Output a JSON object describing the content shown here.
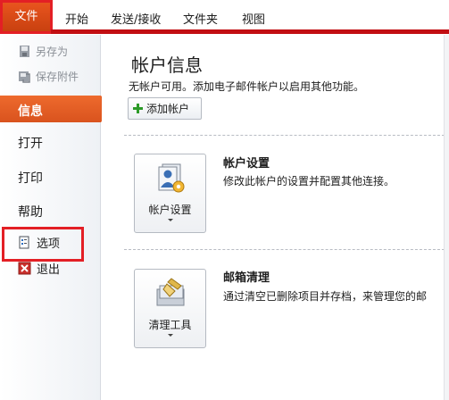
{
  "ribbon": {
    "file_tab": "文件",
    "tabs": [
      "开始",
      "发送/接收",
      "文件夹",
      "视图"
    ]
  },
  "left_nav": {
    "save_as": "另存为",
    "save_attachments": "保存附件",
    "info": "信息",
    "open": "打开",
    "print": "打印",
    "help": "帮助",
    "options": "选项",
    "exit": "退出"
  },
  "main": {
    "title": "帐户信息",
    "subtitle": "无帐户可用。添加电子邮件帐户以启用其他功能。",
    "add_account_label": "添加帐户",
    "account_settings": {
      "button_label": "帐户设置",
      "title": "帐户设置",
      "description": "修改此帐户的设置并配置其他连接。"
    },
    "mailbox_cleanup": {
      "button_label": "清理工具",
      "title": "邮箱清理",
      "description": "通过清空已删除项目并存档，来管理您的邮"
    }
  },
  "colors": {
    "accent_orange": "#e35e24",
    "ribbon_red": "#c20e12",
    "highlight_box": "#e31f25"
  }
}
